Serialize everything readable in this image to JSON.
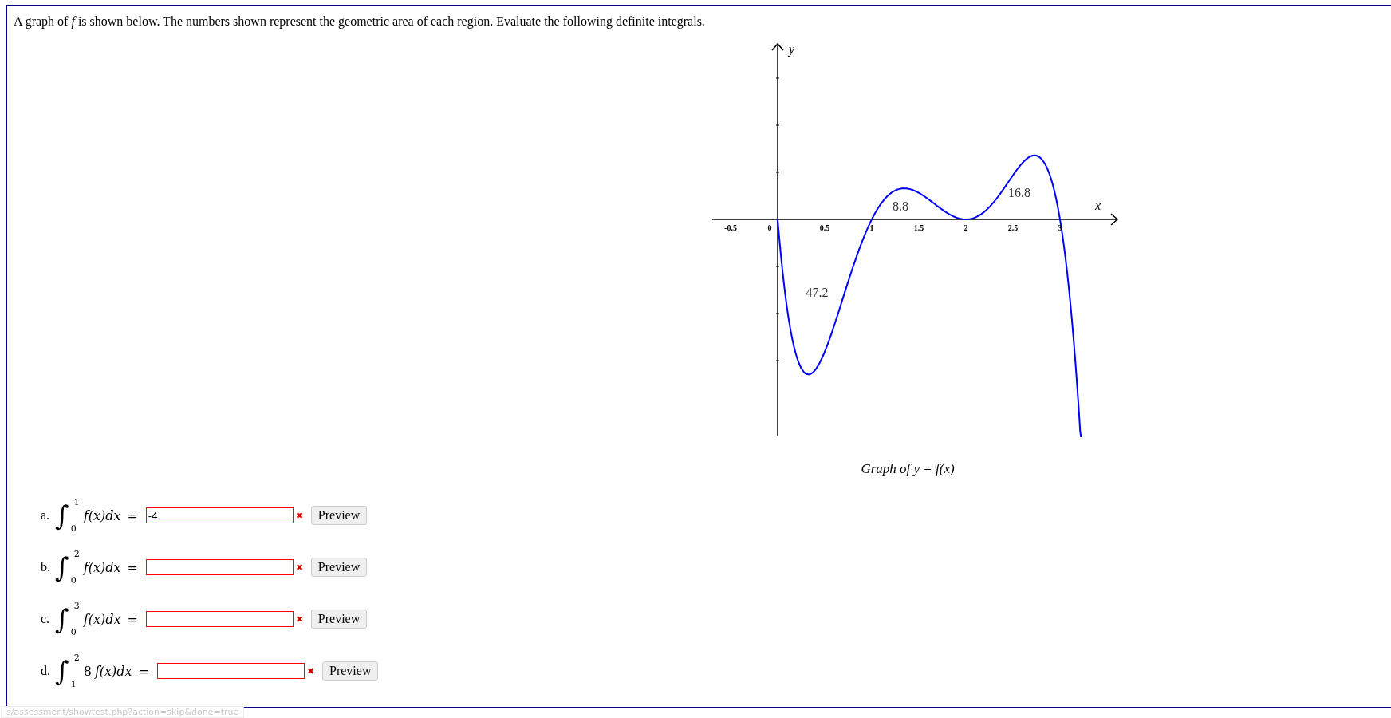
{
  "instructions": "A graph of *f* is shown below. The numbers shown represent the geometric area of each region. Evaluate the following definite integrals.",
  "graph": {
    "x_axis_label": "x",
    "y_axis_label": "y",
    "x_tick_labels": [
      "-0.5",
      "0",
      "0.5",
      "1",
      "1.5",
      "2",
      "2.5",
      "3"
    ],
    "area_labels": [
      "47.2",
      "8.8",
      "16.8"
    ],
    "caption": "Graph of y = f(x)"
  },
  "questions": [
    {
      "label": "a.",
      "integral_sign": "∫",
      "lower": "0",
      "upper": "1",
      "integrand": "f(x)dx",
      "equals": "=",
      "value": "-4",
      "correct": false,
      "status_icon": "✖",
      "button": "Preview"
    },
    {
      "label": "b.",
      "integral_sign": "∫",
      "lower": "0",
      "upper": "2",
      "integrand": "f(x)dx",
      "equals": "=",
      "correct": false,
      "status_icon": "✖",
      "button": "Preview"
    },
    {
      "label": "c.",
      "integral_sign": "∫",
      "lower": "0",
      "upper": "3",
      "integrand": "f(x)dx",
      "equals": "=",
      "correct": false,
      "status_icon": "✖",
      "button": "Preview"
    },
    {
      "label": "d.",
      "integral_sign": "∫",
      "lower": "1",
      "upper": "2",
      "coefficient": "8",
      "integrand": "f(x)dx",
      "equals": "=",
      "correct": false,
      "status_icon": "✖",
      "button": "Preview"
    }
  ],
  "status_bar": {
    "url": "s/assessment/showtest.php?action=skip&done=true"
  }
}
